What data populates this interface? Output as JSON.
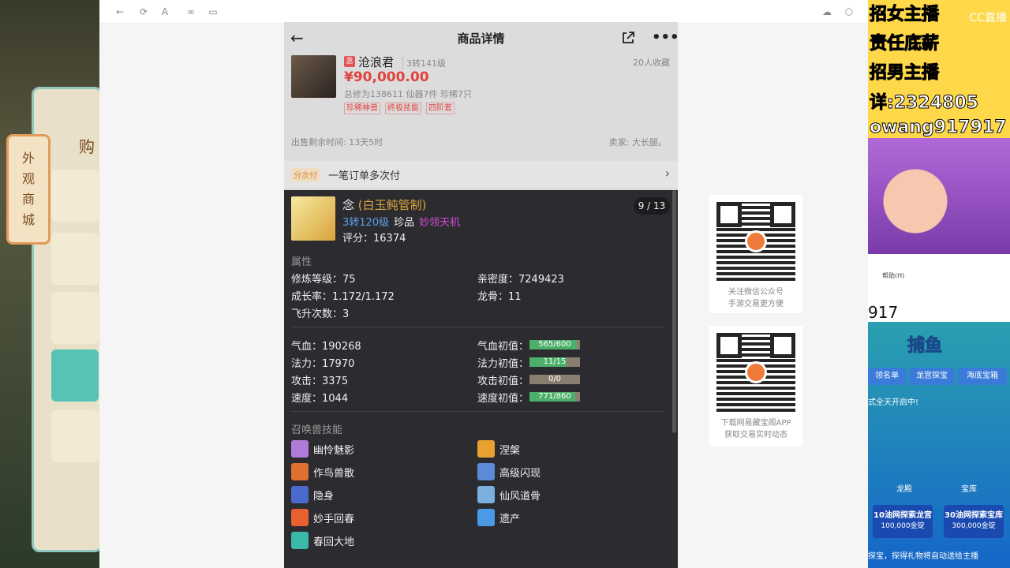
{
  "left_game": {
    "sign_chars": [
      "外",
      "观",
      "商",
      "城"
    ],
    "buy_label": "购"
  },
  "phone": {
    "title": "商品详情",
    "product": {
      "seal": "丞",
      "name": "沧浪君",
      "level": "3转141级",
      "favorites": "20人收藏",
      "price": "¥90,000.00",
      "stats": "总修为138611  仙器7件  珍稀7只",
      "tags": [
        "珍稀神兽",
        "终极技能",
        "四阶套"
      ],
      "time_left": "出售剩余时间: 13天5时",
      "seller": "卖家: 大长腿。"
    },
    "installment": {
      "badge": "分次付",
      "label": "一笔订单多次付"
    },
    "pet": {
      "name": "念",
      "title": "(白玉鲀管制)",
      "turn": "3转120级",
      "rarity": "珍品",
      "special": "妙领天机",
      "score": "评分：16374",
      "pager": "9 / 13",
      "attr_title": "属性",
      "attrs": [
        {
          "k": "修炼等级：",
          "v": "75"
        },
        {
          "k": "亲密度：",
          "v": "7249423"
        },
        {
          "k": "成长率：",
          "v": "1.172/1.172"
        },
        {
          "k": "龙骨：",
          "v": "11"
        },
        {
          "k": "飞升次数：",
          "v": "3"
        }
      ],
      "stats": [
        {
          "k": "气血：",
          "v": "190268",
          "ik": "气血初值：",
          "iv": "565/600",
          "fill": 0.94
        },
        {
          "k": "法力：",
          "v": "17970",
          "ik": "法力初值：",
          "iv": "11/15",
          "fill": 0.73
        },
        {
          "k": "攻击：",
          "v": "3375",
          "ik": "攻击初值：",
          "iv": "0/0",
          "fill": 0
        },
        {
          "k": "速度：",
          "v": "1044",
          "ik": "速度初值：",
          "iv": "771/860",
          "fill": 0.9
        }
      ],
      "skills_title": "召唤兽技能",
      "skills": [
        {
          "name": "幽怜魅影",
          "color": "#b07ad8"
        },
        {
          "name": "涅槃",
          "color": "#e8a030"
        },
        {
          "name": "作鸟兽散",
          "color": "#e07030"
        },
        {
          "name": "高级闪现",
          "color": "#5a8ad8"
        },
        {
          "name": "隐身",
          "color": "#4a6ad0"
        },
        {
          "name": "仙风道骨",
          "color": "#7ab0e0"
        },
        {
          "name": "妙手回春",
          "color": "#e86030"
        },
        {
          "name": "遗产",
          "color": "#4a9ae8"
        },
        {
          "name": "春回大地",
          "color": "#3ab8a8"
        }
      ]
    }
  },
  "qr": [
    {
      "caption1": "关注微信公众号",
      "caption2": "手游交易更方便"
    },
    {
      "caption1": "下载网易藏宝阁APP",
      "caption2": "获取交易实时动态"
    }
  ],
  "stream": {
    "ad_lines": [
      "招女主播",
      "责任底薪",
      "招男主播",
      "详:2324805",
      "owang917917"
    ],
    "cc": "CC直播",
    "menu": "帮助(H)",
    "number": "917",
    "game_logo": "捕鱼",
    "buttons": [
      "领名单",
      "龙宫探宝",
      "海底宝箱"
    ],
    "notice": "式全天开启中!",
    "cards": [
      {
        "title": "10油网探索龙宫",
        "sub": "100,000金锭"
      },
      {
        "title": "30油网探索宝库",
        "sub": "300,000金锭"
      }
    ],
    "labels": [
      "龙殿",
      "宝库"
    ],
    "bottom_line": "探宝，探得礼物将自动送给主播"
  }
}
